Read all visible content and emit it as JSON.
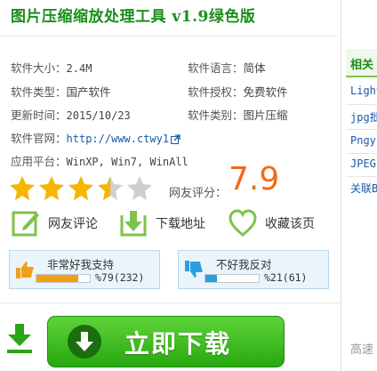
{
  "header": {
    "title": "图片压缩缩放处理工具 v1.9绿色版"
  },
  "info": {
    "size_label": "软件大小：",
    "size_value": "2.4M",
    "lang_label": "软件语言：",
    "lang_value": "简体",
    "type_label": "软件类型：",
    "type_value": "国产软件",
    "license_label": "软件授权：",
    "license_value": "免费软件",
    "updated_label": "更新时间：",
    "updated_value": "2015/10/23",
    "category_label": "软件类别：",
    "category_value": "图片压缩",
    "site_label": "软件官网：",
    "site_value": "http://www.ctwy1",
    "platform_label": "应用平台：",
    "platform_value": "WinXP, Win7, WinAll"
  },
  "rating": {
    "stars": 3.5,
    "max": 5,
    "label": "网友评分：",
    "score": "7.9"
  },
  "actions": {
    "review": "网友评论",
    "download": "下载地址",
    "favorite": "收藏该页"
  },
  "votes": {
    "support": {
      "label": "非常好我支持",
      "percent": 79,
      "text": "%79(232)"
    },
    "oppose": {
      "label": "不好我反对",
      "percent": 21,
      "text": "%21(61)"
    }
  },
  "sidebar": {
    "heading": "相关",
    "items": [
      "Light",
      "jpg批",
      "Pngy",
      "JPEG",
      "关联B"
    ],
    "bottom": "高速"
  },
  "download_button": {
    "label": "立即下载"
  },
  "colors": {
    "green": "#1a8f1a",
    "score": "#f36a16",
    "star": "#f7b500",
    "button": "#3cbf1f"
  }
}
